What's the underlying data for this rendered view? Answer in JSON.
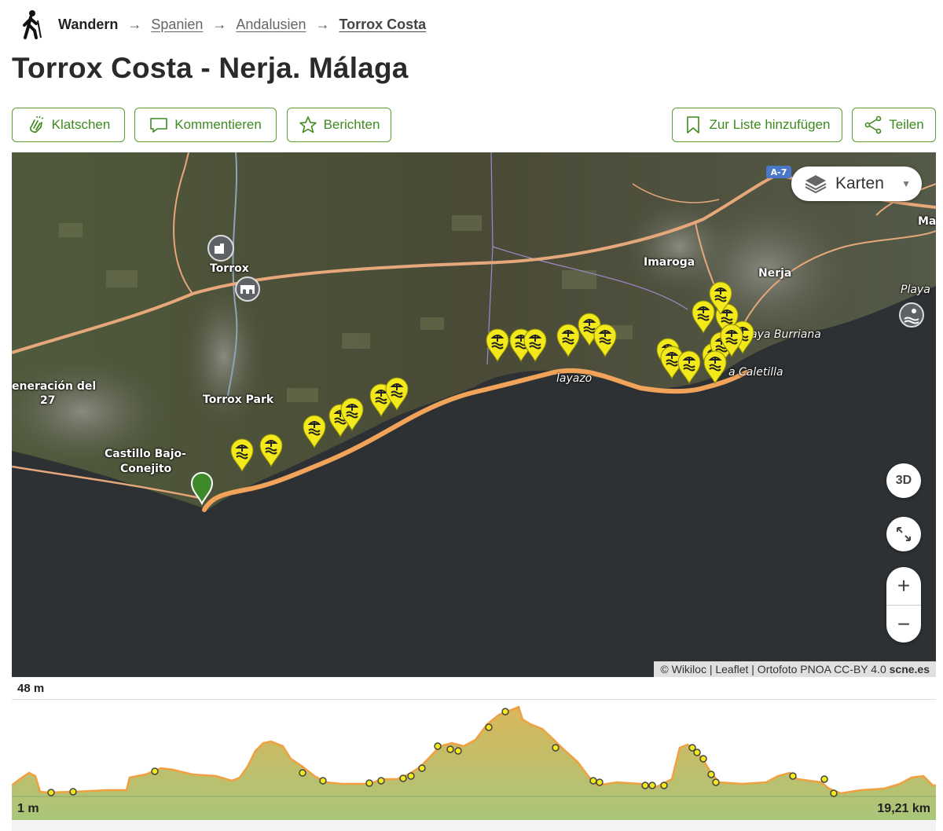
{
  "breadcrumb": {
    "root": "Wandern",
    "items": [
      "Spanien",
      "Andalusien",
      "Torrox Costa"
    ],
    "separator": "→"
  },
  "title": "Torrox Costa - Nerja. Málaga",
  "actions": {
    "clap": "Klatschen",
    "comment": "Kommentieren",
    "report": "Berichten",
    "add_list": "Zur Liste hinzufügen",
    "share": "Teilen"
  },
  "map": {
    "layer_button": "Karten",
    "road_shield": "A-7",
    "places": {
      "torrox": "Torrox",
      "torrox_park": "Torrox Park",
      "castillo": "Castillo Bajo-",
      "conejito": "Conejito",
      "generacion": "eneración del",
      "gen27": "27",
      "imaroga": "Imaroga",
      "nerja": "Nerja",
      "playa": "Playa",
      "ma": "Ma",
      "burriana": "aya Burriana",
      "caletilla": "a Caletilla",
      "playazo": "layazo"
    },
    "controls": {
      "three_d": "3D",
      "zoom_in": "+",
      "zoom_out": "−"
    },
    "attribution": {
      "text": "© Wikiloc | Leaflet | Ortofoto PNOA CC-BY 4.0 ",
      "bold": "scne.es"
    },
    "colors": {
      "track": "#f2a35a",
      "waypoint": "#f2e81a",
      "start": "#3e8a2a",
      "sea": "#2e3134"
    }
  },
  "elevation": {
    "max_label": "48 m",
    "min_label": "1 m",
    "distance_label": "19,21 km",
    "colors": {
      "fill_top": "#d9b65a",
      "fill_bottom": "#a9c67a",
      "line": "#f0a040"
    }
  }
}
